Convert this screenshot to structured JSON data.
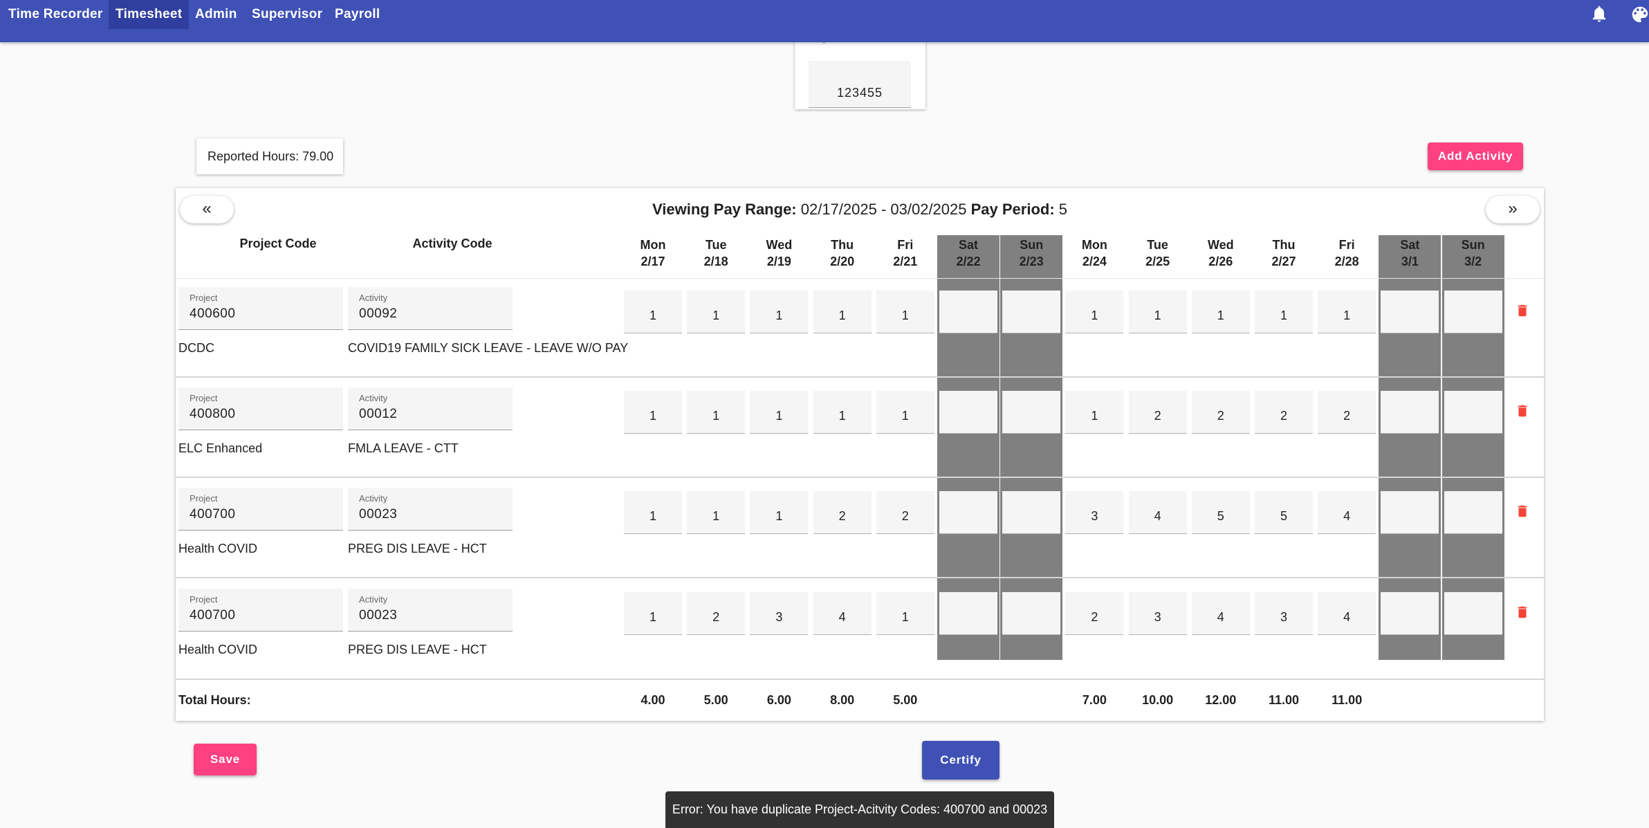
{
  "nav": {
    "items": [
      "Time Recorder",
      "Timesheet",
      "Admin",
      "Supervisor",
      "Payroll"
    ],
    "active": "Timesheet",
    "icons": [
      "bell-icon",
      "palette-icon"
    ]
  },
  "department": {
    "label": "Department Code",
    "value": "123455"
  },
  "reported_hours": "Reported Hours: 79.00",
  "add_activity_label": "Add Activity",
  "pager": {
    "prev": "«",
    "next": "»",
    "range_label": "Viewing Pay Range:",
    "range_value": " 02/17/2025 - 03/02/2025 ",
    "period_label": "Pay Period:",
    "period_value": " 5"
  },
  "columns": {
    "project": "Project Code",
    "activity": "Activity Code"
  },
  "days": [
    {
      "dow": "Mon",
      "date": "2/17",
      "weekend": false
    },
    {
      "dow": "Tue",
      "date": "2/18",
      "weekend": false
    },
    {
      "dow": "Wed",
      "date": "2/19",
      "weekend": false
    },
    {
      "dow": "Thu",
      "date": "2/20",
      "weekend": false
    },
    {
      "dow": "Fri",
      "date": "2/21",
      "weekend": false
    },
    {
      "dow": "Sat",
      "date": "2/22",
      "weekend": true
    },
    {
      "dow": "Sun",
      "date": "2/23",
      "weekend": true
    },
    {
      "dow": "Mon",
      "date": "2/24",
      "weekend": false
    },
    {
      "dow": "Tue",
      "date": "2/25",
      "weekend": false
    },
    {
      "dow": "Wed",
      "date": "2/26",
      "weekend": false
    },
    {
      "dow": "Thu",
      "date": "2/27",
      "weekend": false
    },
    {
      "dow": "Fri",
      "date": "2/28",
      "weekend": false
    },
    {
      "dow": "Sat",
      "date": "3/1",
      "weekend": true
    },
    {
      "dow": "Sun",
      "date": "3/2",
      "weekend": true
    }
  ],
  "field_labels": {
    "project": "Project",
    "activity": "Activity"
  },
  "rows": [
    {
      "project": "400600",
      "activity": "00092",
      "project_name": "DCDC",
      "activity_name": "COVID19 FAMILY SICK LEAVE - LEAVE W/O PAY",
      "hours": [
        "1",
        "1",
        "1",
        "1",
        "1",
        "",
        "",
        "1",
        "1",
        "1",
        "1",
        "1",
        "",
        ""
      ]
    },
    {
      "project": "400800",
      "activity": "00012",
      "project_name": "ELC Enhanced",
      "activity_name": "FMLA LEAVE - CTT",
      "hours": [
        "1",
        "1",
        "1",
        "1",
        "1",
        "",
        "",
        "1",
        "2",
        "2",
        "2",
        "2",
        "",
        ""
      ]
    },
    {
      "project": "400700",
      "activity": "00023",
      "project_name": "Health COVID",
      "activity_name": "PREG DIS LEAVE - HCT",
      "hours": [
        "1",
        "1",
        "1",
        "2",
        "2",
        "",
        "",
        "3",
        "4",
        "5",
        "5",
        "4",
        "",
        ""
      ]
    },
    {
      "project": "400700",
      "activity": "00023",
      "project_name": "Health COVID",
      "activity_name": "PREG DIS LEAVE - HCT",
      "hours": [
        "1",
        "2",
        "3",
        "4",
        "1",
        "",
        "",
        "2",
        "3",
        "4",
        "3",
        "4",
        "",
        ""
      ]
    }
  ],
  "totals": {
    "label": "Total Hours:",
    "values": [
      "4.00",
      "5.00",
      "6.00",
      "8.00",
      "5.00",
      "",
      "",
      "7.00",
      "10.00",
      "12.00",
      "11.00",
      "11.00",
      "",
      ""
    ]
  },
  "save_label": "Save",
  "certify_label": "Certify",
  "error_message": "Error: You have duplicate Project-Acitvity Codes: 400700 and 00023",
  "colors": {
    "primary": "#3f51b5",
    "accent": "#ff4081",
    "weekend": "#808080",
    "delete": "#f44336"
  }
}
